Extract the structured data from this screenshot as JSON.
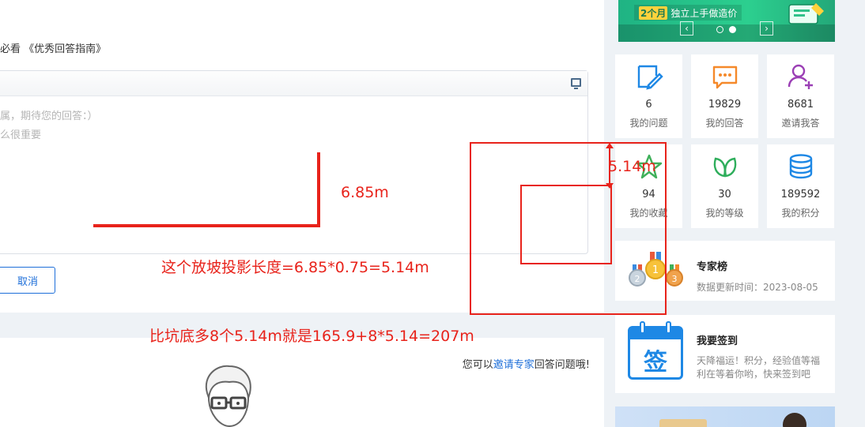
{
  "answer_area": {
    "guide_text": "必看 《优秀回答指南》",
    "placeholder_line1": "属，期待您的回答：）",
    "placeholder_line2": "么很重要",
    "cancel_label": "取消"
  },
  "invite": {
    "prefix": "您可以",
    "link": "邀请专家",
    "suffix": "回答问题哦!"
  },
  "annotations": {
    "length_label": "6.85m",
    "projection_label": "5.14m",
    "formula1": "这个放坡投影长度=6.85*0.75=5.14m",
    "formula2": "比坑底多8个5.14m就是165.9+8*5.14=207m",
    "color": "#e8231b"
  },
  "banner": {
    "tag": "2个月",
    "text": "独立上手做造价",
    "prev_icon": "chevron-left-icon",
    "next_icon": "chevron-right-icon"
  },
  "stats": [
    {
      "value": "6",
      "label": "我的问题",
      "icon": "edit-note-icon",
      "color": "#1e88e5"
    },
    {
      "value": "19829",
      "label": "我的回答",
      "icon": "chat-bubble-icon",
      "color": "#f5892a"
    },
    {
      "value": "8681",
      "label": "邀请我答",
      "icon": "add-user-icon",
      "color": "#9b3fb5"
    },
    {
      "value": "94",
      "label": "我的收藏",
      "icon": "star-icon",
      "color": "#3fb05a"
    },
    {
      "value": "30",
      "label": "我的等级",
      "icon": "leaf-icon",
      "color": "#2fae5c"
    },
    {
      "value": "189592",
      "label": "我的积分",
      "icon": "coins-stack-icon",
      "color": "#1e88e5"
    }
  ],
  "expert": {
    "title": "专家榜",
    "subtitle": "数据更新时间：2023-08-05"
  },
  "signin": {
    "title": "我要签到",
    "line1": "天降福运！积分，经验值等福",
    "line2": "利在等着你哟，快来签到吧",
    "badge_char": "签"
  }
}
